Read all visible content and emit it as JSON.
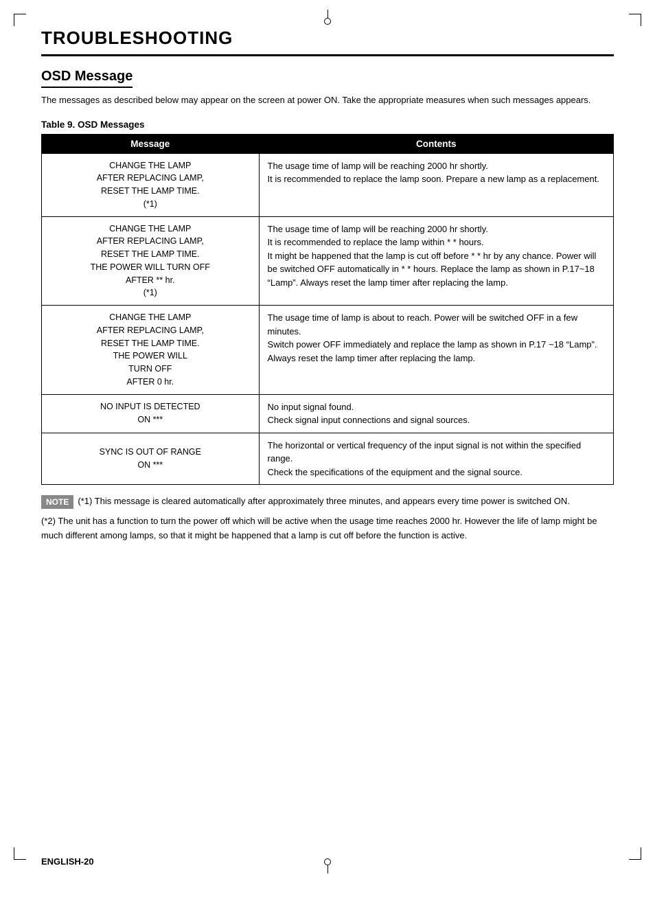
{
  "page": {
    "title": "TROUBLESHOOTING",
    "section": {
      "title": "OSD Message",
      "description": "The messages as described below may appear on the screen at power ON. Take the appropriate measures when such messages appears."
    },
    "table": {
      "title": "Table 9. OSD Messages",
      "col_message": "Message",
      "col_contents": "Contents",
      "rows": [
        {
          "message": "CHANGE THE LAMP\nAFTER REPLACING LAMP,\nRESET THE LAMP TIME.\n(*1)",
          "contents": "The usage time of lamp will be reaching 2000 hr shortly.\nIt is recommended to replace the lamp soon.  Prepare a new lamp as a replacement."
        },
        {
          "message": "CHANGE THE LAMP\nAFTER REPLACING LAMP,\nRESET THE LAMP TIME.\nTHE POWER WILL TURN OFF\nAFTER ** hr.\n(*1)",
          "contents": "The usage time of lamp will be reaching 2000 hr shortly.\nIt is recommended to replace the lamp within * * hours.\nIt might be happened that the lamp is cut off before * * hr by any chance.  Power will be switched OFF automatically in * * hours.  Replace the lamp as shown in P.17~18 “Lamp”.  Always reset the lamp timer after replacing the lamp."
        },
        {
          "message": "CHANGE THE LAMP\nAFTER REPLACING LAMP,\nRESET THE LAMP TIME.\nTHE POWER WILL\nTURN OFF\nAFTER 0 hr.",
          "contents": "The usage time of lamp is about to reach.  Power will be switched OFF in a few minutes.\nSwitch power OFF immediately and replace the lamp as shown in P.17 ~18 “Lamp”.  Always reset the lamp timer after replacing the lamp."
        },
        {
          "message": "NO INPUT IS DETECTED\nON ***",
          "contents": "No input signal found.\nCheck signal input connections and signal sources."
        },
        {
          "message": "SYNC IS OUT OF RANGE\nON ***",
          "contents": "The horizontal or vertical frequency of the input signal is not within the specified range.\nCheck the specifications of the equipment and the signal source."
        }
      ]
    },
    "note": {
      "label": "NOTE",
      "text": "(*1) This message is cleared automatically after approximately three minutes, and appears every time power is switched ON."
    },
    "footnote": "(*2) The unit has a function to turn the power off which will be active when the usage time reaches 2000 hr.  However the life of lamp might be much different among lamps, so that it might be happened that a lamp is cut off before the function is active.",
    "footer": "ENGLISH-20"
  }
}
